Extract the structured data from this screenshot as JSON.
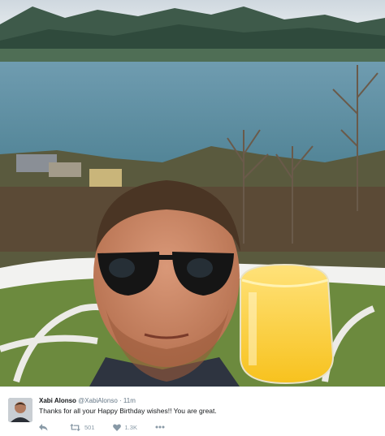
{
  "tweet": {
    "display_name": "Xabi Alonso",
    "handle": "@XabiAlonso",
    "separator": "·",
    "time": "11m",
    "text": "Thanks for all your Happy Birthday wishes!! You are great.",
    "retweet_count": "501",
    "like_count": "1.3K"
  },
  "icons": {
    "reply": "reply-icon",
    "retweet": "retweet-icon",
    "like": "heart-icon",
    "more": "more-dots-icon"
  },
  "colors": {
    "action_gray": "#8899a6",
    "meta_gray": "#657786",
    "text_dark": "#14171a"
  }
}
